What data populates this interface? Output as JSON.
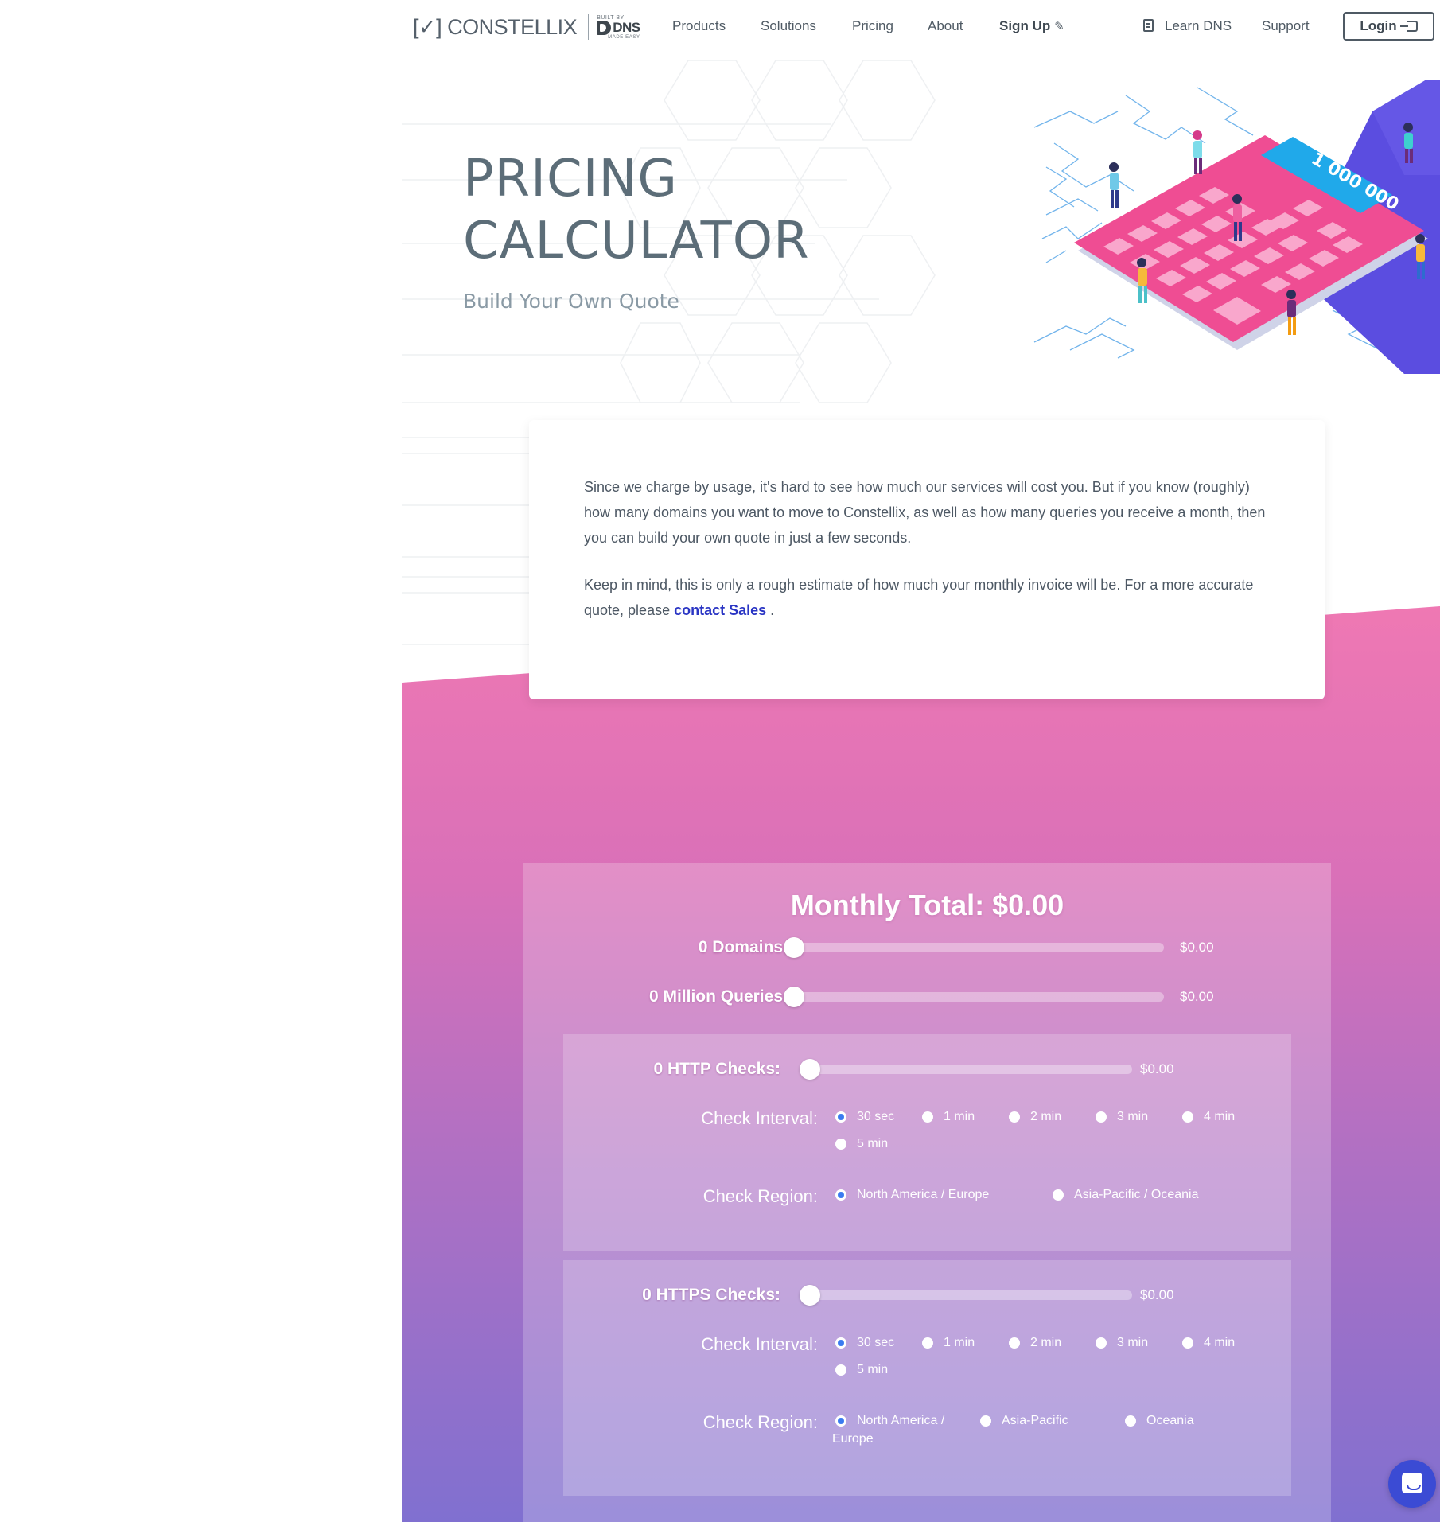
{
  "header": {
    "logo_text": "[✓] CONSTELLIX",
    "partner_logo": {
      "built_by": "BUILT BY",
      "brand": "DNS",
      "tagline": "MADE EASY"
    },
    "nav": [
      "Products",
      "Solutions",
      "Pricing",
      "About"
    ],
    "signup_label": "Sign Up",
    "learn_dns_label": "Learn DNS",
    "support_label": "Support",
    "login_label": "Login"
  },
  "hero": {
    "title_line1": "PRICING",
    "title_line2": "CALCULATOR",
    "subtitle": "Build Your Own Quote",
    "illustration_display": "1 000 000"
  },
  "intro": {
    "p1": "Since we charge by usage, it's hard to see how much our services will cost you. But if you know (roughly) how many domains you want to move to Constellix, as well as how many queries you receive a month, then you can build your own quote in just a few seconds.",
    "p2_before": "Keep in mind, this is only a rough estimate of how much your monthly invoice will be. For a more accurate quote, please ",
    "p2_link": "contact Sales",
    "p2_after": " ."
  },
  "calculator": {
    "total_label": "Monthly Total: $0.00",
    "domains": {
      "label": "0 Domains:",
      "price": "$0.00",
      "value": 0
    },
    "queries": {
      "label": "0 Million Queries:",
      "price": "$0.00",
      "value": 0
    },
    "http": {
      "label": "0 HTTP Checks:",
      "price": "$0.00",
      "value": 0,
      "interval_label": "Check Interval:",
      "intervals": [
        "30 sec",
        "1 min",
        "2 min",
        "3 min",
        "4 min",
        "5 min"
      ],
      "interval_selected": "30 sec",
      "region_label": "Check Region:",
      "regions": [
        "North America / Europe",
        "Asia-Pacific / Oceania"
      ],
      "region_selected": "North America / Europe"
    },
    "https": {
      "label": "0 HTTPS Checks:",
      "price": "$0.00",
      "value": 0,
      "interval_label": "Check Interval:",
      "intervals": [
        "30 sec",
        "1 min",
        "2 min",
        "3 min",
        "4 min",
        "5 min"
      ],
      "interval_selected": "30 sec",
      "region_label": "Check Region:",
      "regions": [
        "North America /",
        "Asia-Pacific",
        "Oceania"
      ],
      "region_first_line2": "Europe",
      "region_selected": "North America /"
    }
  },
  "colors": {
    "band_top": "#ec78b3",
    "band_bottom": "#8b72d3",
    "accent_link": "#2a35c4",
    "radio_on": "#3a7bf0",
    "chat": "#3b4bd4"
  },
  "icons": [
    "pencil-icon",
    "book-icon",
    "login-icon",
    "chat-icon"
  ]
}
